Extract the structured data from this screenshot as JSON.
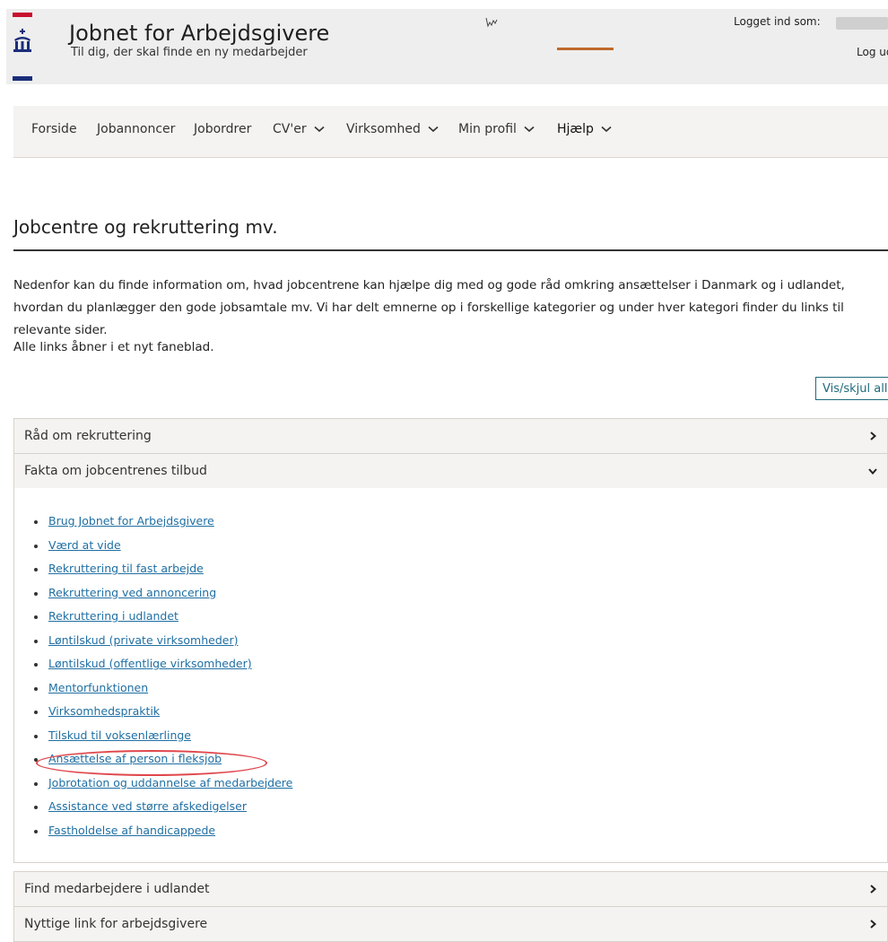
{
  "header": {
    "title": "Jobnet for Arbejdsgivere",
    "subtitle": "Til dig, der skal finde en ny medarbejder",
    "logged_in_label": "Logget ind som:",
    "logout_label": "Log ud"
  },
  "nav": {
    "items": [
      {
        "label": "Forside"
      },
      {
        "label": "Jobannoncer"
      },
      {
        "label": "Jobordrer"
      },
      {
        "label": "CV'er"
      },
      {
        "label": "Virksomhed"
      },
      {
        "label": "Min profil"
      },
      {
        "label": "Hjælp"
      }
    ],
    "active": "Hjælp"
  },
  "page": {
    "title": "Jobcentre og rekruttering mv.",
    "intro": "Nedenfor kan du finde information om, hvad jobcentrene kan hjælpe dig med og gode råd omkring ansættelser i Danmark og i udlandet, hvordan du planlægger den gode jobsamtale mv. Vi har delt emnerne op i forskellige kategorier og under hver kategori finder du links til relevante sider.",
    "note": "Alle links åbner i et nyt faneblad.",
    "toggle_all_label": "Vis/skjul alle"
  },
  "accordion": [
    {
      "label": "Råd om rekruttering",
      "expanded": false
    },
    {
      "label": "Fakta om jobcentrenes tilbud",
      "expanded": true,
      "links": [
        "Brug Jobnet for Arbejdsgivere",
        "Værd at vide",
        "Rekruttering til fast arbejde",
        "Rekruttering ved annoncering",
        "Rekruttering i udlandet",
        "Løntilskud (private virksomheder)",
        "Løntilskud (offentlige virksomheder)",
        "Mentorfunktionen",
        "Virksomhedspraktik",
        "Tilskud til voksenlærlinge",
        "Ansættelse af person i fleksjob",
        "Jobrotation og uddannelse af medarbejdere",
        "Assistance ved større afskedigelser",
        "Fastholdelse af handicappede"
      ],
      "highlighted_link": "Ansættelse af person i fleksjob"
    },
    {
      "label": "Find medarbejdere i udlandet",
      "expanded": false
    },
    {
      "label": "Nyttige link for arbejdsgivere",
      "expanded": false
    }
  ],
  "colors": {
    "link": "#1f6fa3",
    "nav_active": "#c0692b",
    "button_border": "#1f6a7a",
    "highlight_circle": "#e0474c",
    "flag_red": "#c8102e",
    "flag_blue": "#1a2e7a"
  },
  "icons": {
    "logo": "crown-logo-icon",
    "collapsed": "chevron-right-icon",
    "expanded": "chevron-down-icon",
    "nav_dropdown": "chevron-down-icon"
  }
}
